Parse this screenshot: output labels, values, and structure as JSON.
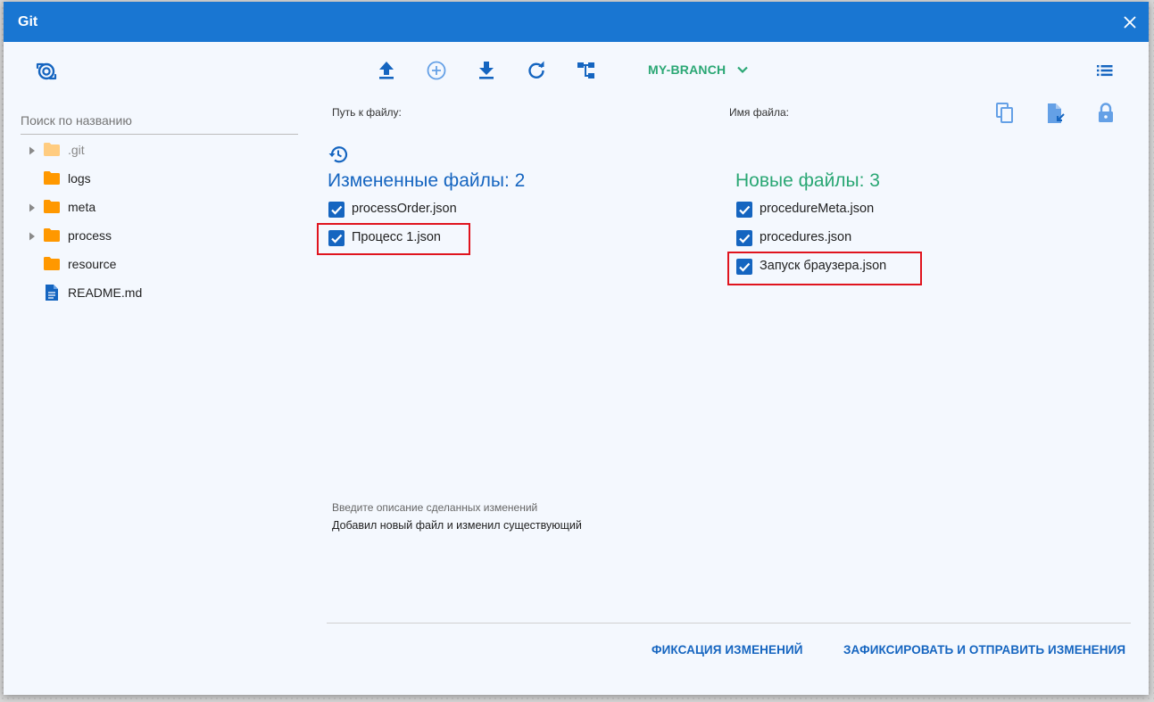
{
  "window": {
    "title": "Git",
    "close_icon": "close-icon"
  },
  "toolbar": {
    "left_icon": "git-settings-icon",
    "icons": [
      "push-upload-icon",
      "add-circle-icon",
      "pull-download-icon",
      "refresh-icon",
      "branches-icon",
      "list-menu-icon"
    ],
    "branch": "MY-BRANCH"
  },
  "sidebar": {
    "search_placeholder": "Поиск по названию",
    "items": [
      {
        "label": ".git",
        "icon": "folder-icon",
        "expandable": true
      },
      {
        "label": "logs",
        "icon": "folder-icon",
        "expandable": false
      },
      {
        "label": "meta",
        "icon": "folder-icon",
        "expandable": true
      },
      {
        "label": "process",
        "icon": "folder-icon",
        "expandable": true
      },
      {
        "label": "resource",
        "icon": "folder-icon",
        "expandable": false
      },
      {
        "label": "README.md",
        "icon": "file-icon",
        "expandable": false
      }
    ]
  },
  "main": {
    "path_label": "Путь к файлу:",
    "filename_label": "Имя файла:",
    "right_icons": [
      "copy-icon",
      "file-export-icon",
      "lock-icon"
    ],
    "history_icon": "history-icon",
    "changed": {
      "title": "Измененные файлы: 2",
      "files": [
        {
          "name": "processOrder.json",
          "checked": true
        },
        {
          "name": "Процесс 1.json",
          "checked": true
        }
      ]
    },
    "new": {
      "title": "Новые файлы: 3",
      "files": [
        {
          "name": "procedureMeta.json",
          "checked": true
        },
        {
          "name": "procedures.json",
          "checked": true
        },
        {
          "name": "Запуск браузера.json",
          "checked": true
        }
      ]
    },
    "description": {
      "label": "Введите описание сделанных изменений",
      "value": "Добавил новый файл и изменил существующий"
    },
    "actions": {
      "commit": "ФИКСАЦИЯ ИЗМЕНЕНИЙ",
      "commit_push": "ЗАФИКСИРОВАТЬ И ОТПРАВИТЬ ИЗМЕНЕНИЯ"
    }
  },
  "colors": {
    "titlebar": "#1976d2",
    "primary": "#1565c0",
    "green": "#2aa774",
    "folder": "#ff9800",
    "highlight": "#e0141e"
  }
}
